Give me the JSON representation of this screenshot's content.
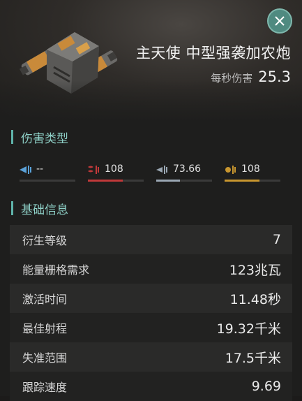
{
  "item": {
    "name": "主天使 中型强袭加农炮",
    "dps_label": "每秒伤害",
    "dps_value": "25.3"
  },
  "damage_section": {
    "title": "伤害类型",
    "types": [
      {
        "icon": "em-damage-icon",
        "value": "--",
        "color": "#5aa0d6",
        "fill": 0
      },
      {
        "icon": "thermal-damage-icon",
        "value": "108",
        "color": "#c0393a",
        "fill": 0.62
      },
      {
        "icon": "kinetic-damage-icon",
        "value": "73.66",
        "color": "#9aa7b3",
        "fill": 0.42
      },
      {
        "icon": "explosive-damage-icon",
        "value": "108",
        "color": "#c8962f",
        "fill": 0.62
      }
    ]
  },
  "basic_section": {
    "title": "基础信息",
    "rows": [
      {
        "label": "衍生等级",
        "value": "7"
      },
      {
        "label": "能量栅格需求",
        "value": "123兆瓦"
      },
      {
        "label": "激活时间",
        "value": "11.48秒"
      },
      {
        "label": "最佳射程",
        "value": "19.32千米"
      },
      {
        "label": "失准范围",
        "value": "17.5千米"
      },
      {
        "label": "跟踪速度",
        "value": "9.69"
      }
    ]
  }
}
